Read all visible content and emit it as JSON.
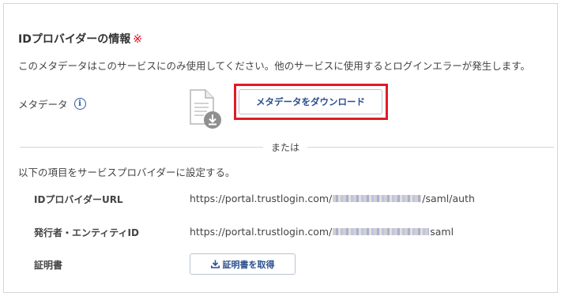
{
  "section": {
    "title": "IDプロバイダーの情報",
    "required_mark": "※"
  },
  "note": "このメタデータはこのサービスにのみ使用してください。他のサービスに使用するとログインエラーが発生します。",
  "metadata": {
    "label": "メタデータ",
    "info_icon": "info-icon",
    "document_icon": "document-download-icon",
    "download_button": "メタデータをダウンロード"
  },
  "divider": {
    "text": "または"
  },
  "instruction": "以下の項目をサービスプロバイダーに設定する。",
  "fields": [
    {
      "label": "IDプロバイダーURL",
      "value_prefix": "https://portal.trustlogin.com/",
      "value_suffix": "/saml/auth"
    },
    {
      "label": "発行者・エンティティID",
      "value_prefix": "https://portal.trustlogin.com/",
      "value_suffix": "saml"
    },
    {
      "label": "証明書",
      "button": "証明書を取得",
      "button_icon": "download-icon"
    }
  ],
  "colors": {
    "accent": "#2b4f8f",
    "required": "#e60012",
    "highlight": "#e01b24",
    "border": "#d3d6da"
  }
}
